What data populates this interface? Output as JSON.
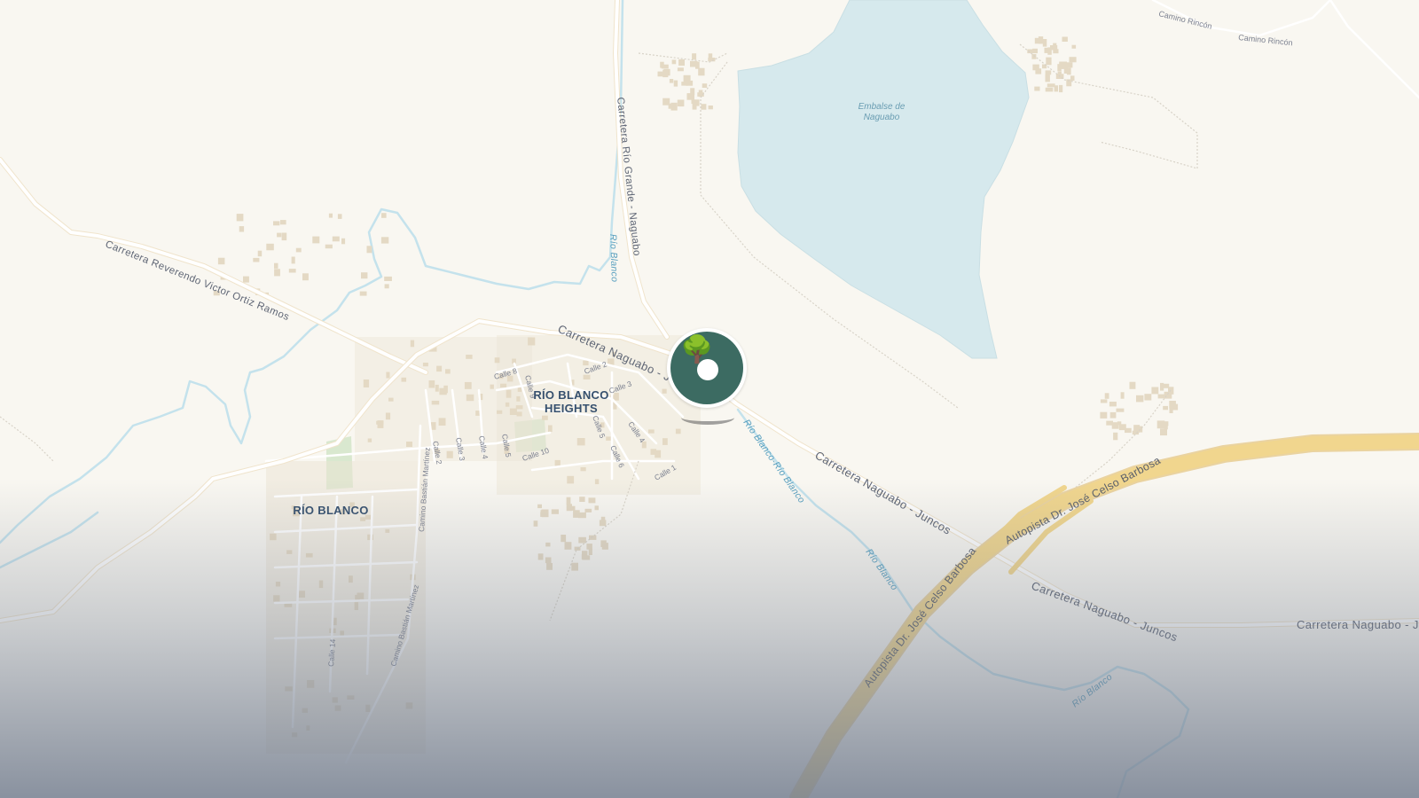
{
  "map": {
    "places": {
      "rio_blanco_heights_1": "RÍO BLANCO",
      "rio_blanco_heights_2": "HEIGHTS",
      "rio_blanco": "RÍO BLANCO"
    },
    "water": {
      "lake_1": "Embalse de",
      "lake_2": "Naguabo",
      "river_1": "Río Blanco",
      "river_2": "Río Blanco-Río Blanco",
      "river_3": "Río Blanco",
      "river_4": "Río Blanco"
    },
    "roads": {
      "reverendo": "Carretera Reverendo Victor Ortiz Ramos",
      "rio_grande": "Carretera Río Grande - Naguabo",
      "naguabo_juncos_1": "Carretera Naguabo - Juncos",
      "naguabo_juncos_2": "Carretera Naguabo - Juncos",
      "naguabo_juncos_3": "Carretera Naguabo - Juncos",
      "naguabo_juncos_4": "Carretera Naguabo - J",
      "rincon_1": "Camino Rincón",
      "rincon_2": "Camino Rincón",
      "bastian_1": "Camino Bastián Martínez",
      "bastian_2": "Camino Bastián Martínez",
      "autopista_1": "Autopista Dr. José Celso Barbosa",
      "autopista_2": "Autopista Dr. José Celso Barbosa"
    },
    "streets": {
      "calle_1": "Calle 1",
      "calle_2a": "Calle 2",
      "calle_2b": "Calle 2",
      "calle_3a": "Calle 3",
      "calle_3b": "Calle 3",
      "calle_4a": "Calle 4",
      "calle_4b": "Calle 4",
      "calle_5a": "Calle 5",
      "calle_5b": "Calle 5",
      "calle_6": "Calle 6",
      "calle_8": "Calle 8",
      "calle_9": "Calle 9",
      "calle_10": "Calle 10",
      "calle_14": "Calle 14"
    },
    "marker": {
      "icon": "tree-icon",
      "emoji": "🌳",
      "color": "#3c6b62"
    },
    "colors": {
      "land": "#f9f7f1",
      "water": "#d6e9ed",
      "river": "#bfe0ea",
      "highway": "#f1d68e",
      "road": "#ffffff"
    }
  }
}
